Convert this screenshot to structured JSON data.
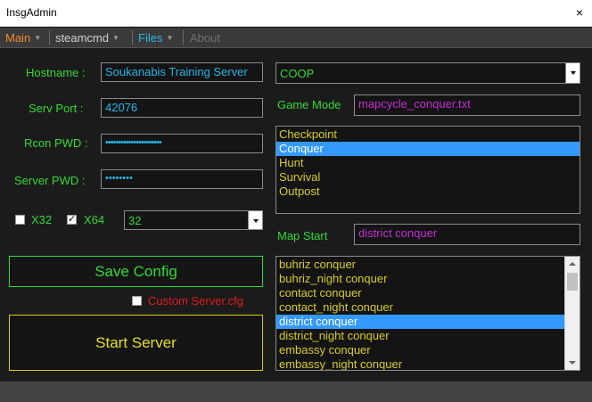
{
  "window": {
    "title": "InsgAdmin",
    "close_glyph": "×"
  },
  "menu": {
    "main": "Main",
    "steamcmd": "steamcmd",
    "files": "Files",
    "about": "About",
    "colors": {
      "main": "#f28c28",
      "steamcmd": "#d0d0d0",
      "files": "#25b6e8",
      "about": "#6e6e6e"
    }
  },
  "form": {
    "hostname_label": "Hostname :",
    "hostname_value": "Soukanabis Training Server",
    "port_label": "Serv Port :",
    "port_value": "42076",
    "rcon_label": "Rcon PWD :",
    "rcon_value": "••••••••••••••••••••••",
    "server_pwd_label": "Server PWD :",
    "server_pwd_value": "••••••••",
    "x32_label": "X32",
    "x32_checked": false,
    "x64_label": "X64",
    "x64_checked": true,
    "arch_select_value": "32"
  },
  "buttons": {
    "save_config": "Save Config",
    "custom_cfg_label": "Custom Server.cfg",
    "custom_cfg_checked": false,
    "start_server": "Start Server"
  },
  "game": {
    "type_select_value": "COOP",
    "game_mode_label": "Game Mode",
    "mapcycle_value": "mapcycle_conquer.txt",
    "modes": [
      "Checkpoint",
      "Conquer",
      "Hunt",
      "Survival",
      "Outpost"
    ],
    "selected_mode_index": 1,
    "map_start_label": "Map Start",
    "map_start_value": "district conquer",
    "maps": [
      "buhriz conquer",
      "buhriz_night conquer",
      "contact conquer",
      "contact_night conquer",
      "district conquer",
      "district_night conquer",
      "embassy conquer",
      "embassy_night conquer"
    ],
    "selected_map_index": 4
  },
  "icons": {
    "close": "close-icon",
    "dropdown": "chevron-down-icon",
    "scroll_up": "scroll-up-icon",
    "scroll_down": "scroll-down-icon",
    "check": "check-icon"
  },
  "colors": {
    "label_green": "#33d933",
    "value_cyan": "#25b6e8",
    "value_magenta": "#c42cd6",
    "list_yellow": "#d8cc22",
    "selection_blue": "#3399ff"
  }
}
